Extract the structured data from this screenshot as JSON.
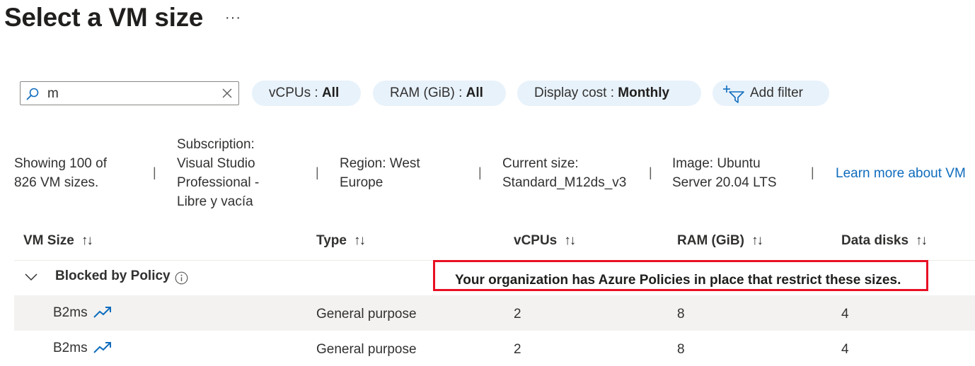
{
  "header": {
    "title": "Select a VM size",
    "more": "···"
  },
  "search": {
    "value": "m"
  },
  "filters": [
    {
      "label": "vCPUs : ",
      "value": "All"
    },
    {
      "label": "RAM (GiB) : ",
      "value": "All"
    },
    {
      "label": "Display cost : ",
      "value": "Monthly"
    }
  ],
  "add_filter": {
    "label": "Add filter"
  },
  "info_bar": {
    "showing": [
      "Showing 100 of",
      "826 VM sizes."
    ],
    "subscription": [
      "Subscription:",
      "Visual Studio",
      "Professional -",
      "Libre y vacía"
    ],
    "region": [
      "Region: West",
      "Europe"
    ],
    "current_size": [
      "Current size:",
      "Standard_M12ds_v3"
    ],
    "image": [
      "Image: Ubuntu",
      "Server 20.04 LTS"
    ],
    "separator": "|",
    "learn_more": "Learn more about VM"
  },
  "table": {
    "columns": [
      "VM Size",
      "Type",
      "vCPUs",
      "RAM (GiB)",
      "Data disks"
    ],
    "sort_glyph": "↑↓",
    "group": {
      "name": "Blocked by Policy",
      "message": "Your organization has Azure Policies in place that restrict these sizes."
    },
    "rows": [
      {
        "size": "B2ms",
        "type": "General purpose",
        "vcpus": "2",
        "ram": "8",
        "disks": "4"
      },
      {
        "size": "B2ms",
        "type": "General purpose",
        "vcpus": "2",
        "ram": "8",
        "disks": "4"
      }
    ]
  },
  "colors": {
    "accent": "#0f6cbd",
    "pill": "#e8f2fb",
    "alert": "#e81123",
    "row_highlight": "#f3f2f1"
  }
}
